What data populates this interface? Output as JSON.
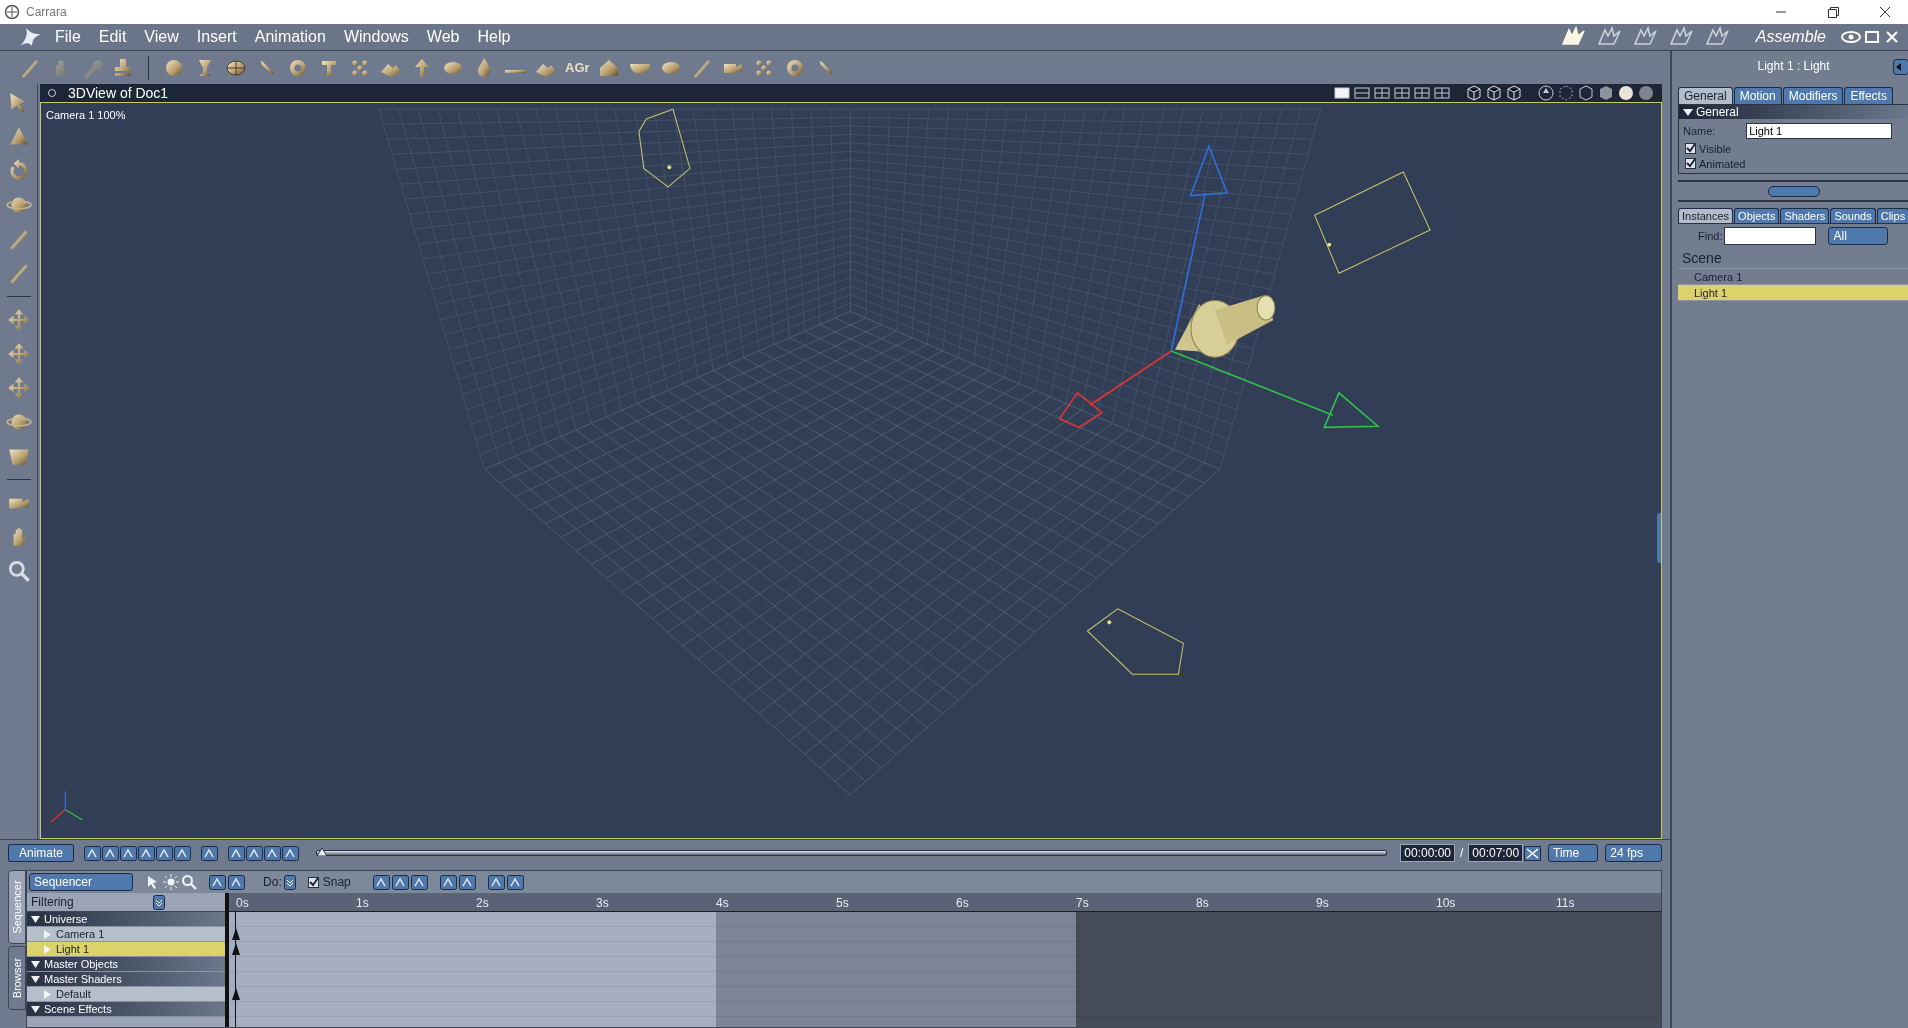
{
  "window": {
    "title": "Carrara"
  },
  "menu": [
    "File",
    "Edit",
    "View",
    "Insert",
    "Animation",
    "Windows",
    "Web",
    "Help"
  ],
  "rooms": {
    "label": "Assemble",
    "items": [
      {
        "selected": true
      },
      {
        "selected": false
      },
      {
        "selected": false
      },
      {
        "selected": false
      },
      {
        "selected": false
      }
    ]
  },
  "toolbar": {
    "text_tool": "AGr"
  },
  "viewport": {
    "title": "3DView of Doc1",
    "camera_label": "Camera 1 100%"
  },
  "properties": {
    "title": "Light 1 : Light",
    "tabs": [
      {
        "label": "General",
        "selected": true
      },
      {
        "label": "Motion",
        "selected": false
      },
      {
        "label": "Modifiers",
        "selected": false
      },
      {
        "label": "Effects",
        "selected": false
      }
    ],
    "section": {
      "label": "General",
      "expanded": true
    },
    "name_label": "Name:",
    "name_value": "Light 1",
    "checkboxes": [
      {
        "label": "Visible",
        "checked": true
      },
      {
        "label": "Animated",
        "checked": true
      }
    ]
  },
  "browser": {
    "tabs": [
      {
        "label": "Instances",
        "selected": true
      },
      {
        "label": "Objects",
        "selected": false
      },
      {
        "label": "Shaders",
        "selected": false
      },
      {
        "label": "Sounds",
        "selected": false
      },
      {
        "label": "Clips",
        "selected": false
      }
    ],
    "find_label": "Find:",
    "filter": "All",
    "scene": "Scene",
    "items": [
      {
        "label": "Camera 1",
        "selected": false
      },
      {
        "label": "Light 1",
        "selected": true
      }
    ]
  },
  "animation": {
    "animate_button": "Animate",
    "time_slider": {
      "level": 0
    },
    "time_current": "00:00:00",
    "separator": "/",
    "time_total": "00:07:00",
    "time_mode": "Time",
    "fps": "24 fps"
  },
  "sequencer": {
    "side_tabs": [
      {
        "label": "Sequencer",
        "selected": true
      },
      {
        "label": "Browser",
        "selected": false
      }
    ],
    "mode": "Sequencer",
    "do_label": "Do:",
    "snap": {
      "label": "Snap",
      "checked": true
    },
    "filtering": "Filtering",
    "ruler": [
      "0s",
      "1s",
      "2s",
      "3s",
      "4s",
      "5s",
      "6s",
      "7s",
      "8s",
      "9s",
      "10s",
      "11s"
    ],
    "tree": [
      {
        "label": "Universe",
        "expanded": true,
        "selected": false,
        "keyframe": false,
        "children": [
          {
            "label": "Camera 1",
            "expanded": false,
            "selected": false,
            "keyframe": true
          },
          {
            "label": "Light 1",
            "expanded": false,
            "selected": true,
            "keyframe": true
          }
        ]
      },
      {
        "label": "Master Objects",
        "expanded": true,
        "selected": false,
        "keyframe": false
      },
      {
        "label": "Master Shaders",
        "expanded": true,
        "selected": false,
        "keyframe": false,
        "children": [
          {
            "label": "Default",
            "expanded": false,
            "selected": false,
            "keyframe": true
          }
        ]
      },
      {
        "label": "Scene Effects",
        "expanded": true,
        "selected": false,
        "keyframe": false
      }
    ]
  }
}
